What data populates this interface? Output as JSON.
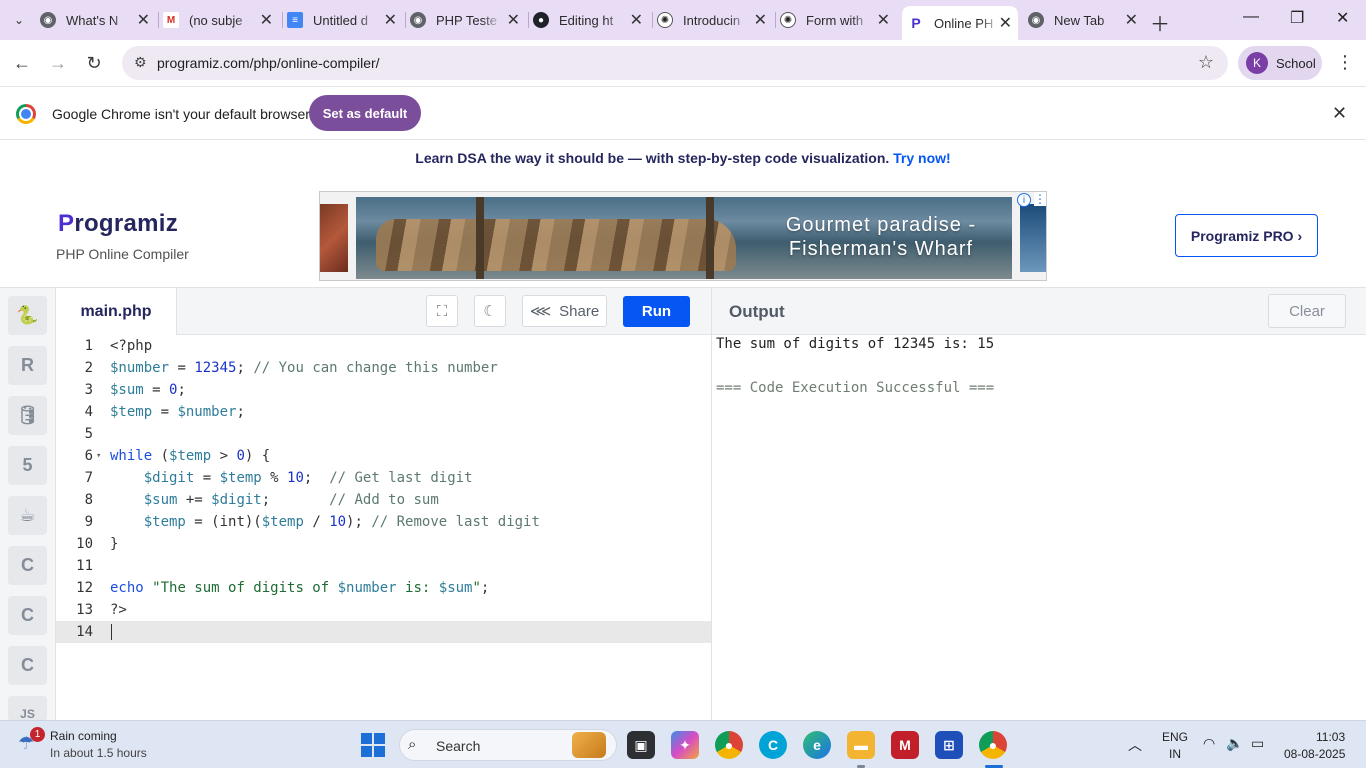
{
  "browser": {
    "tabs": [
      {
        "title": "What's N",
        "icon": "chrome-icon"
      },
      {
        "title": "(no subje",
        "icon": "gmail-icon"
      },
      {
        "title": "Untitled d",
        "icon": "docs-icon"
      },
      {
        "title": "PHP Teste",
        "icon": "chrome-icon"
      },
      {
        "title": "Editing ht",
        "icon": "github-icon"
      },
      {
        "title": "Introducin",
        "icon": "openai-icon"
      },
      {
        "title": "Form with",
        "icon": "openai-icon"
      },
      {
        "title": "Online PH",
        "icon": "programiz-icon",
        "active": true
      },
      {
        "title": "New Tab",
        "icon": "chrome-icon"
      }
    ],
    "url": "programiz.com/php/online-compiler/",
    "profile_initial": "K",
    "profile_name": "School",
    "infobar_message": "Google Chrome isn't your default browser",
    "infobar_button": "Set as default"
  },
  "page": {
    "promo_text": "Learn DSA the way it should be — with step-by-step code visualization.",
    "promo_link": "Try now!",
    "logo_p": "P",
    "logo_rest": "rogramiz",
    "subtitle": "PHP Online Compiler",
    "ad_text_line1": "Gourmet paradise -",
    "ad_text_line2": "Fisherman's Wharf",
    "pro_button": "Programiz PRO ›"
  },
  "compiler": {
    "languages": [
      "python-icon",
      "r-icon",
      "sql-icon",
      "html-icon",
      "java-icon",
      "c-icon",
      "cpp-icon",
      "csharp-icon",
      "js-icon"
    ],
    "language_glyphs": [
      "🐍",
      "R",
      "🛢",
      "5",
      "☕",
      "C",
      "C",
      "C",
      "JS"
    ],
    "filename": "main.php",
    "share_label": "Share",
    "run_label": "Run",
    "output_label": "Output",
    "clear_label": "Clear",
    "code_lines": [
      "<?php",
      "$number = 12345; // You can change this number",
      "$sum = 0;",
      "$temp = $number;",
      "",
      "while ($temp > 0) {",
      "    $digit = $temp % 10;  // Get last digit",
      "    $sum += $digit;       // Add to sum",
      "    $temp = (int)($temp / 10); // Remove last digit",
      "}",
      "",
      "echo \"The sum of digits of $number is: $sum\";",
      "?>",
      ""
    ],
    "output_lines": [
      "The sum of digits of 12345 is: 15",
      "=== Code Execution Successful ==="
    ]
  },
  "taskbar": {
    "weather_title": "Rain coming",
    "weather_sub": "In about 1.5 hours",
    "weather_badge": "1",
    "search_placeholder": "Search",
    "lang_top": "ENG",
    "lang_bottom": "IN",
    "time": "11:03",
    "date": "08-08-2025"
  },
  "colors": {
    "accent": "#0556f3",
    "tabstrip": "#e9ddf5",
    "set_default": "#7b4e9c"
  }
}
